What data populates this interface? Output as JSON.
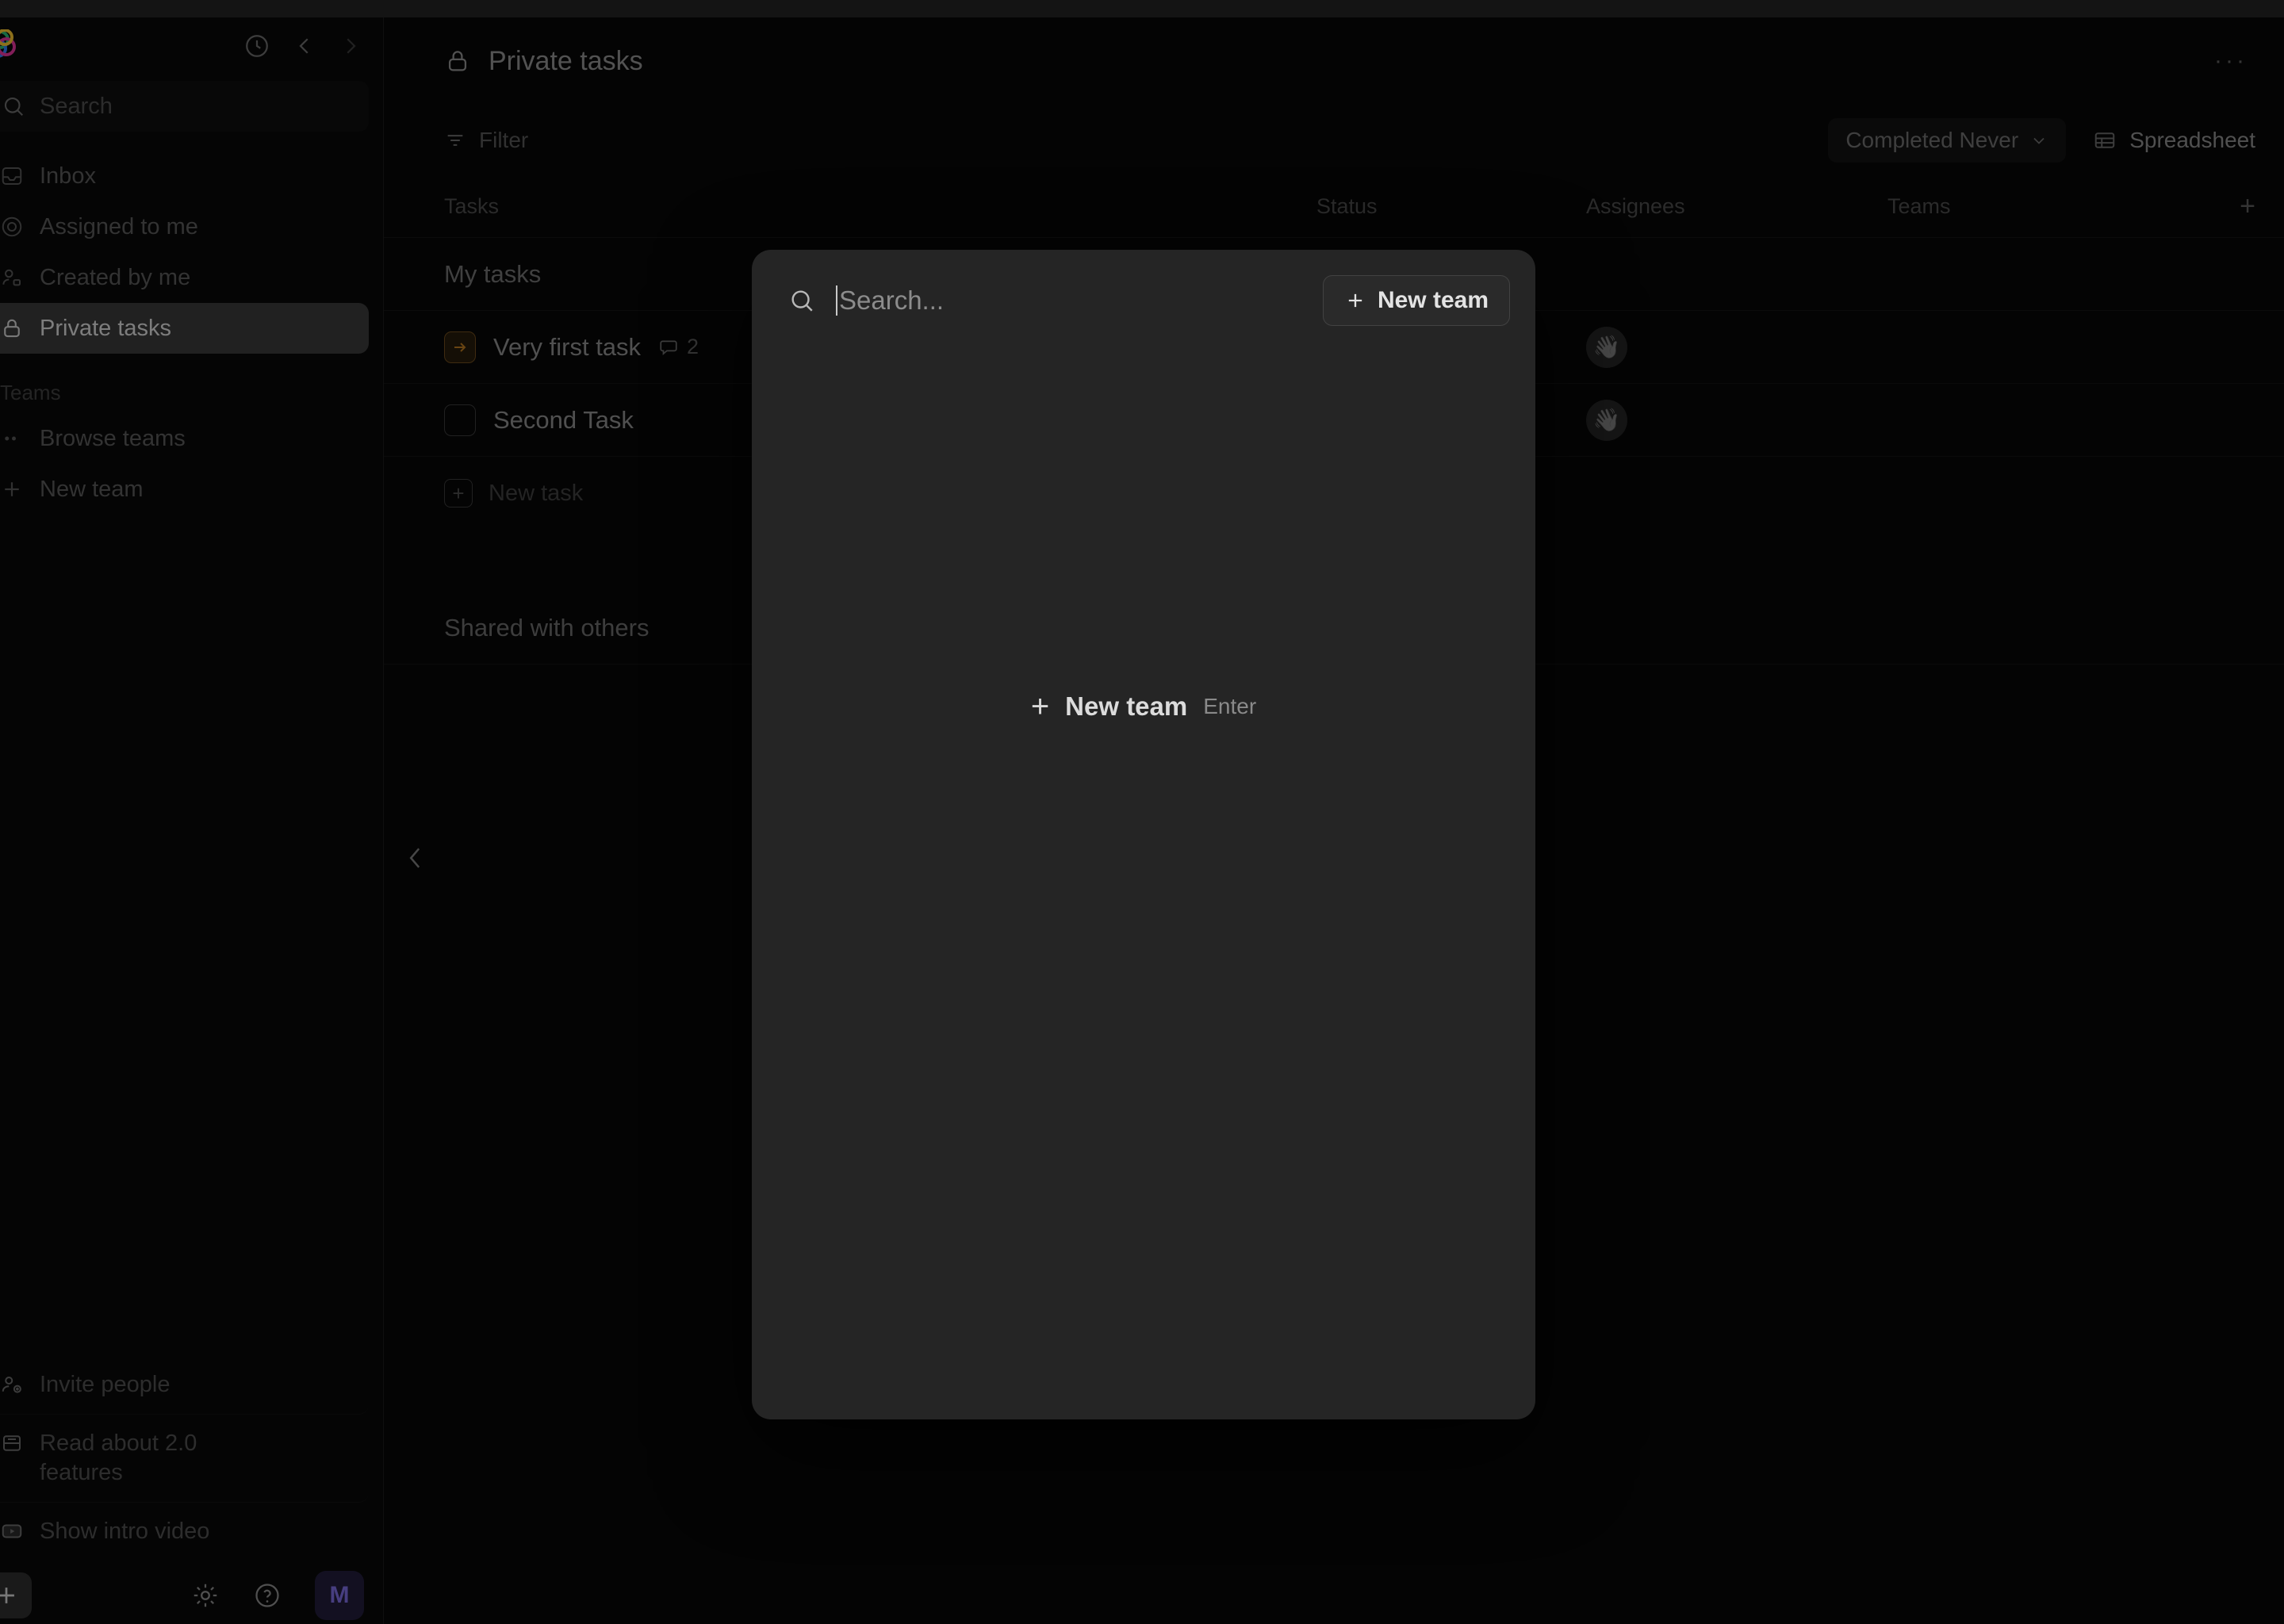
{
  "window": {
    "title_strip": ""
  },
  "sidebar": {
    "logo": "app-logo",
    "top_icons": [
      {
        "name": "history-icon",
        "glyph": "clock"
      },
      {
        "name": "nav-back-icon",
        "glyph": "chevron-left"
      },
      {
        "name": "nav-forward-icon",
        "glyph": "chevron-right"
      }
    ],
    "search": {
      "placeholder": "Search",
      "icon": "search-icon"
    },
    "nav_items": [
      {
        "label": "Inbox",
        "icon": "inbox-icon",
        "active": false
      },
      {
        "label": "Assigned to me",
        "icon": "target-icon",
        "active": false
      },
      {
        "label": "Created by me",
        "icon": "user-edit-icon",
        "active": false
      },
      {
        "label": "Private tasks",
        "icon": "lock-icon",
        "active": true
      }
    ],
    "teams_section_label": "Teams",
    "team_items": [
      {
        "label": "Browse teams",
        "icon": "dots-icon"
      },
      {
        "label": "New team",
        "icon": "plus-icon"
      }
    ],
    "bottom_items": [
      {
        "label": "Invite people",
        "icon": "invite-person-icon"
      },
      {
        "label": "Read about 2.0 features",
        "icon": "document-icon"
      },
      {
        "label": "Show intro video",
        "icon": "play-video-icon"
      }
    ],
    "footer": {
      "add_label": "+",
      "icons": [
        {
          "name": "settings-gear-icon"
        },
        {
          "name": "help-question-icon"
        }
      ],
      "avatar_initial": "M"
    }
  },
  "main": {
    "page_title": "Private tasks",
    "page_title_icon": "lock-icon",
    "more_menu": "···",
    "toolbar": {
      "filter_label": "Filter",
      "filter_icon": "filter-icon",
      "completed_filter_label": "Completed Never",
      "completed_filter_caret": "⌄",
      "view_label": "Spreadsheet",
      "view_icon": "table-icon"
    },
    "columns": [
      {
        "key": "tasks",
        "label": "Tasks"
      },
      {
        "key": "status",
        "label": "Status"
      },
      {
        "key": "assignees",
        "label": "Assignees"
      },
      {
        "key": "teams",
        "label": "Teams"
      }
    ],
    "add_column_label": "+",
    "groups": [
      {
        "name": "My tasks",
        "rows": [
          {
            "title": "Very first task",
            "marker": "arrow-right-chip",
            "comment_icon": "comment-icon",
            "comment_count": "2",
            "status": "",
            "assignee_avatar": "👋",
            "teams": ""
          },
          {
            "title": "Second Task",
            "marker": "checkbox-chip",
            "comment_icon": "",
            "comment_count": "",
            "status": "",
            "assignee_avatar": "👋",
            "teams": ""
          }
        ],
        "new_task_label": "New task",
        "new_task_icon": "plus-square-icon"
      },
      {
        "name": "Shared with others",
        "rows": [],
        "new_task_label": "",
        "new_task_icon": ""
      }
    ],
    "collapse_panel_icon": "chevron-left-icon"
  },
  "modal": {
    "search_placeholder": "Search...",
    "search_icon": "search-icon",
    "new_team_button": "New team",
    "new_team_button_icon": "plus-icon",
    "empty_action_label": "New team",
    "empty_action_icon": "plus-icon",
    "empty_action_shortcut": "Enter"
  },
  "colors": {
    "app_background": "#070707",
    "sidebar_background": "#090909",
    "modal_background": "#252525",
    "accent_orange": "#b5761f",
    "avatar_purple": "#7b6bdd"
  }
}
